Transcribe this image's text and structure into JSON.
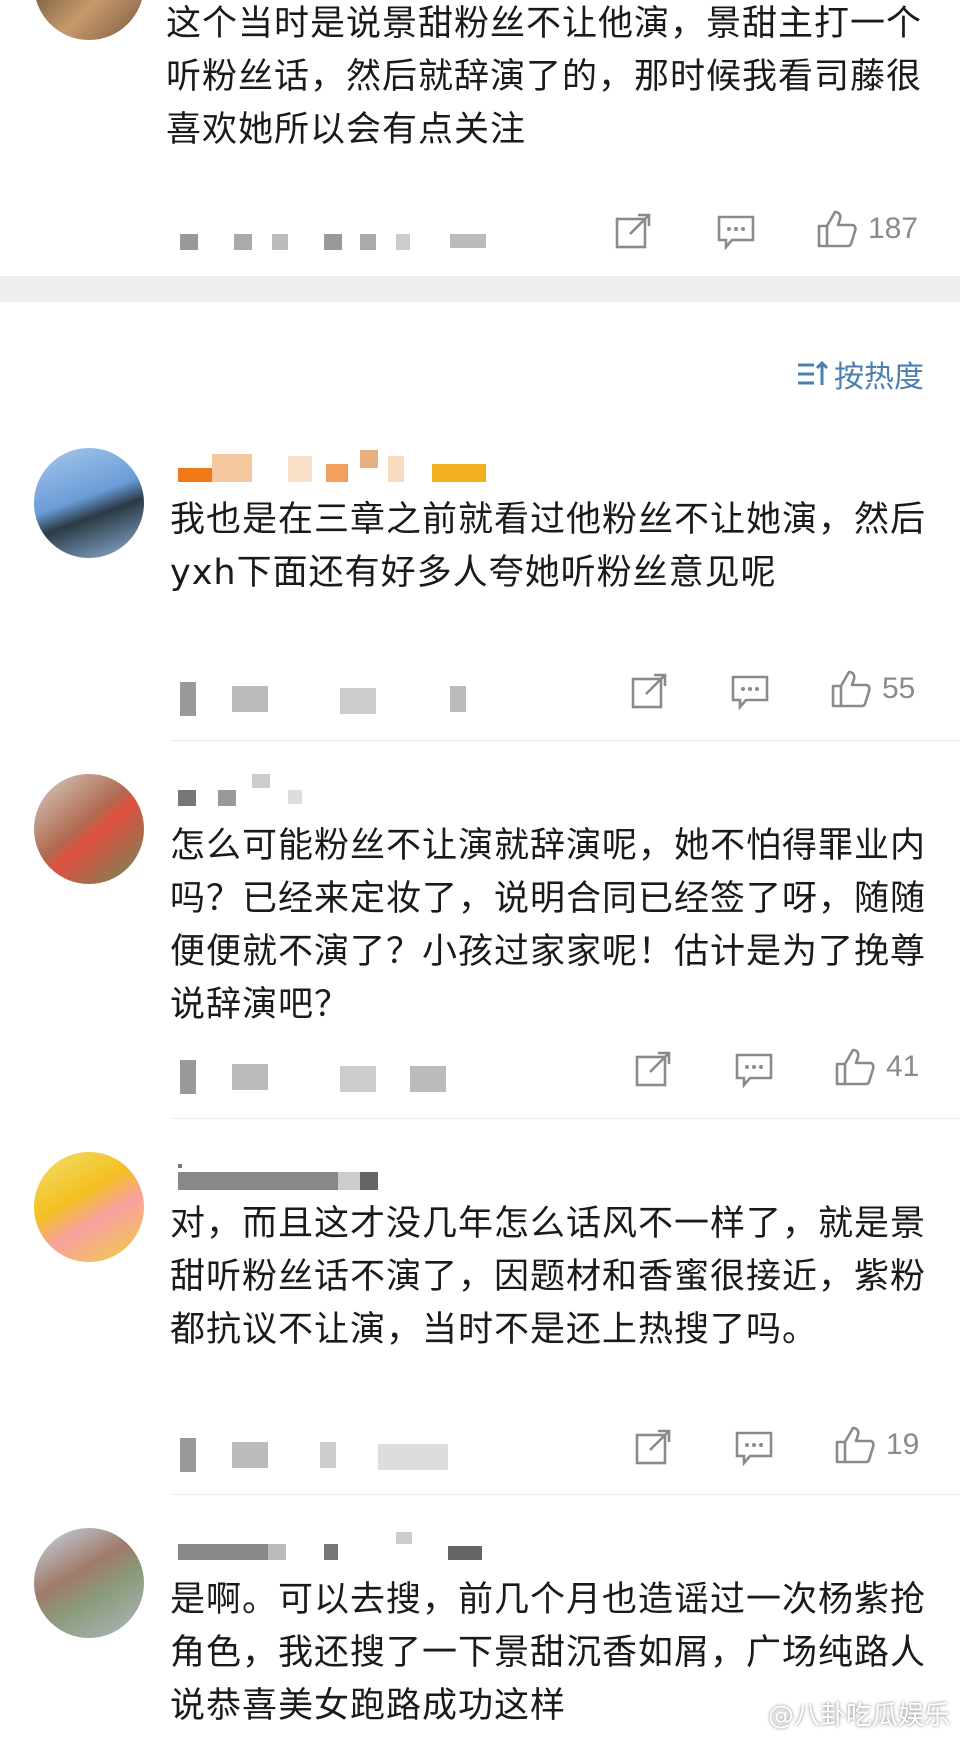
{
  "sort": {
    "label": "按热度",
    "icon": "sort-icon"
  },
  "comments": [
    {
      "text": "这个当时是说景甜粉丝不让他演，景甜主打一个听粉丝话，然后就辞演了的，那时候我看司藤很喜欢她所以会有点关注",
      "likes": "187"
    },
    {
      "text": "我也是在三章之前就看过他粉丝不让她演，然后yxh下面还有好多人夸她听粉丝意见呢",
      "likes": "55"
    },
    {
      "text": "怎么可能粉丝不让演就辞演呢，她不怕得罪业内吗？已经来定妆了，说明合同已经签了呀，随随便便就不演了？小孩过家家呢！估计是为了挽尊说辞演吧？",
      "likes": "41"
    },
    {
      "text": "对，而且这才没几年怎么话风不一样了，就是景甜听粉丝话不演了，因题材和香蜜很接近，紫粉都抗议不让演，当时不是还上热搜了吗。",
      "likes": "19"
    },
    {
      "text": "是啊。可以去搜，前几个月也造谣过一次杨紫抢角色，我还搜了一下景甜沉香如屑，广场纯路人说恭喜美女跑路成功这样",
      "likes": ""
    }
  ],
  "icons": {
    "share": "share-icon",
    "reply": "comment-icon",
    "like": "thumbs-up-icon"
  },
  "colors": {
    "accent": "#4a7fb0",
    "muted": "#8a8a8a",
    "band": "#eeeeee"
  }
}
